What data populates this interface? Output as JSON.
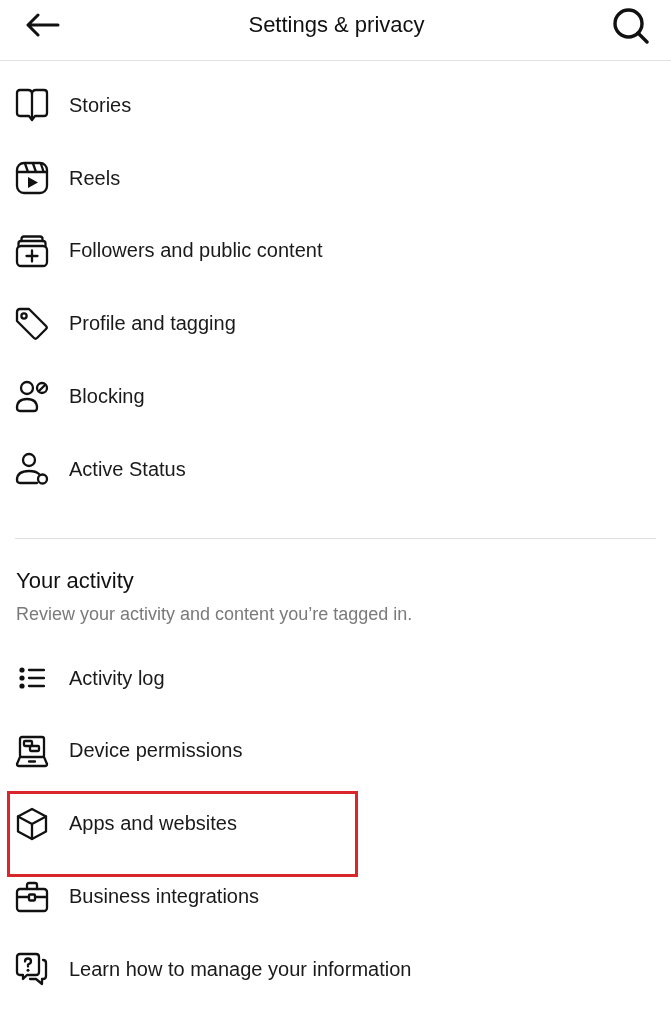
{
  "header": {
    "title": "Settings & privacy"
  },
  "sections": [
    {
      "items": [
        {
          "label": "Stories",
          "highlighted": false
        },
        {
          "label": "Reels",
          "highlighted": false
        },
        {
          "label": "Followers and public content",
          "highlighted": false
        },
        {
          "label": "Profile and tagging",
          "highlighted": false
        },
        {
          "label": "Blocking",
          "highlighted": false
        },
        {
          "label": "Active Status",
          "highlighted": false
        }
      ]
    },
    {
      "title": "Your activity",
      "description": "Review your activity and content you’re tagged in.",
      "items": [
        {
          "label": "Activity log",
          "highlighted": false
        },
        {
          "label": "Device permissions",
          "highlighted": false
        },
        {
          "label": "Apps and websites",
          "highlighted": true
        },
        {
          "label": "Business integrations",
          "highlighted": false
        },
        {
          "label": "Learn how to manage your information",
          "highlighted": false
        }
      ]
    }
  ]
}
